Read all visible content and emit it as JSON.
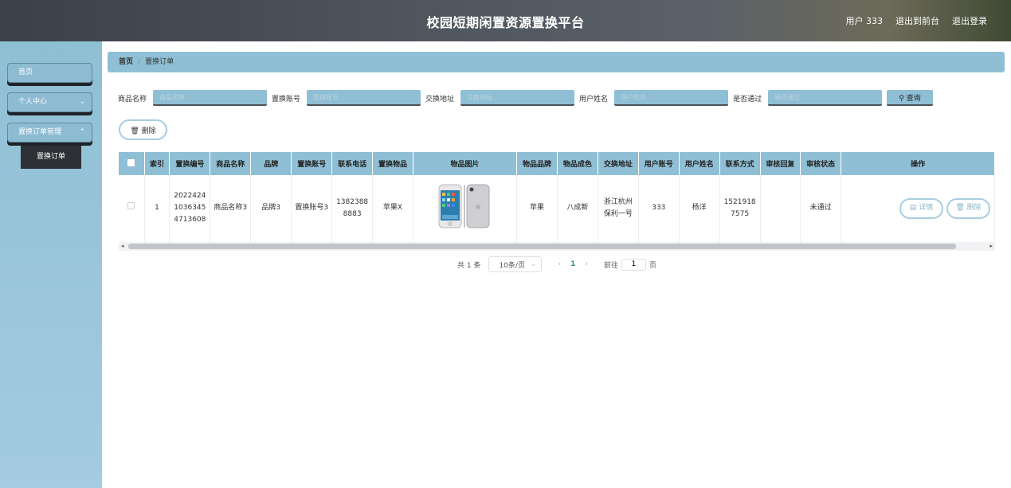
{
  "header": {
    "title": "校园短期闲置资源置换平台",
    "user_label": "用户 333",
    "back_front": "退出到前台",
    "logout": "退出登录"
  },
  "sidebar": {
    "home": "首页",
    "personal": "个人中心",
    "orders_mgmt": "置换订单管理",
    "orders": "置换订单"
  },
  "breadcrumb": {
    "home": "首页",
    "sep": "/",
    "current": "置换订单"
  },
  "search": {
    "fields": [
      {
        "label": "商品名称",
        "placeholder": "商品名称"
      },
      {
        "label": "置换账号",
        "placeholder": "置换账号"
      },
      {
        "label": "交换地址",
        "placeholder": "交换地址"
      },
      {
        "label": "用户姓名",
        "placeholder": "用户姓名"
      },
      {
        "label": "是否通过",
        "placeholder": "是否通过"
      }
    ],
    "query_button": "查询",
    "delete_button": "删除"
  },
  "table": {
    "headers": [
      "索引",
      "置换编号",
      "商品名称",
      "品牌",
      "置换账号",
      "联系电话",
      "置换物品",
      "物品图片",
      "物品品牌",
      "物品成色",
      "交换地址",
      "用户账号",
      "用户姓名",
      "联系方式",
      "审核回复",
      "审核状态",
      "操作"
    ],
    "rows": [
      {
        "index": "1",
        "order_no": "20224241036345 4713608",
        "product_name": "商品名称3",
        "brand": "品牌3",
        "swap_account": "置换账号3",
        "phone": "13823888883",
        "swap_item": "苹果X",
        "item_brand": "苹果",
        "condition": "八成新",
        "address": "浙江杭州保利一号",
        "user_account": "333",
        "user_name": "杨洋",
        "contact": "15219187575",
        "review_reply": "",
        "review_status": "未通过",
        "detail_label": "详情",
        "delete_label": "删除"
      }
    ]
  },
  "pager": {
    "total": "共 1 条",
    "page_size": "10条/页",
    "current": "1",
    "goto_label": "前往",
    "goto_value": "1",
    "page_unit": "页"
  }
}
